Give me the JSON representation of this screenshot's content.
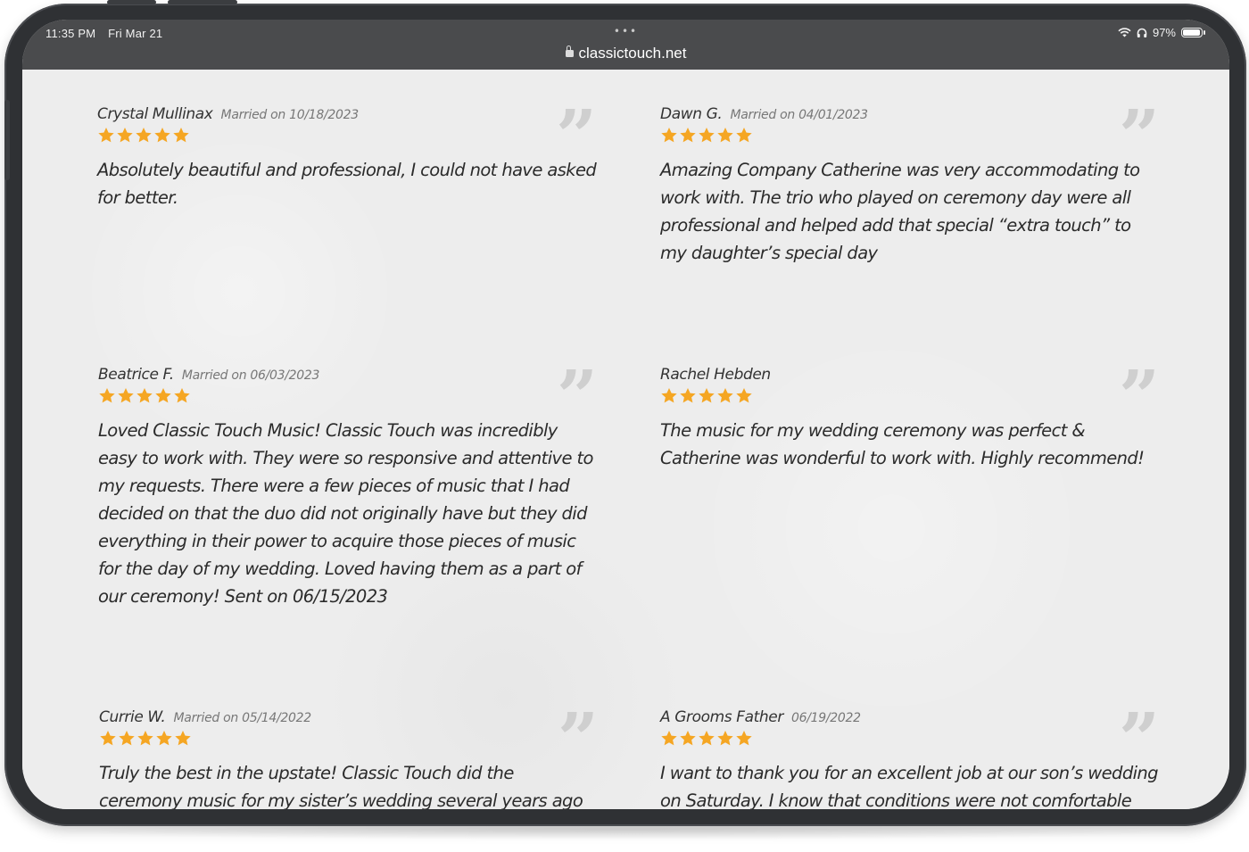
{
  "status_bar": {
    "time": "11:35 PM",
    "date": "Fri Mar 21",
    "battery": "97%",
    "battery_level": 0.97
  },
  "browser": {
    "url": "classictouch.net",
    "more_dots": "•••"
  },
  "quote_glyph": "”",
  "reviews": [
    {
      "name": "Crystal Mullinax",
      "married": "Married on 10/18/2023",
      "rating": 5,
      "text": "Absolutely beautiful and professional, I could not have asked for better."
    },
    {
      "name": "Dawn G.",
      "married": "Married on 04/01/2023",
      "rating": 5,
      "text": "Amazing Company Catherine was very accommodating to work with. The trio who played on ceremony day were all professional and helped add that special “extra touch” to my daughter’s special day"
    },
    {
      "name": "Beatrice F.",
      "married": "Married on 06/03/2023",
      "rating": 5,
      "text": "Loved Classic Touch Music! Classic Touch was incredibly easy to work with. They were so responsive and attentive to my requests. There were a few pieces of music that I had decided on that the duo did not originally have but they did everything in their power to acquire those pieces of music for the day of my wedding. Loved having them as a part of our ceremony! Sent on 06/15/2023"
    },
    {
      "name": "Rachel Hebden",
      "married": "",
      "rating": 5,
      "text": "The music for my wedding ceremony was perfect & Catherine was wonderful to work with. Highly recommend!"
    },
    {
      "name": "Currie W.",
      "married": "Married on 05/14/2022",
      "rating": 5,
      "text": "Truly the best in the upstate! Classic Touch did the ceremony music for my sister’s wedding several years ago and of all the"
    },
    {
      "name": "A Grooms Father",
      "married": "06/19/2022",
      "rating": 5,
      "text": "I want to thank you for an excellent job at our son’s wedding on Saturday. I know that conditions were not comfortable but the"
    }
  ],
  "colors": {
    "star": "#f5a623",
    "frame": "#2f3134",
    "topbar": "#4a4b4d",
    "page_bg": "#ededed",
    "quote_mark": "#cfcfcf"
  }
}
